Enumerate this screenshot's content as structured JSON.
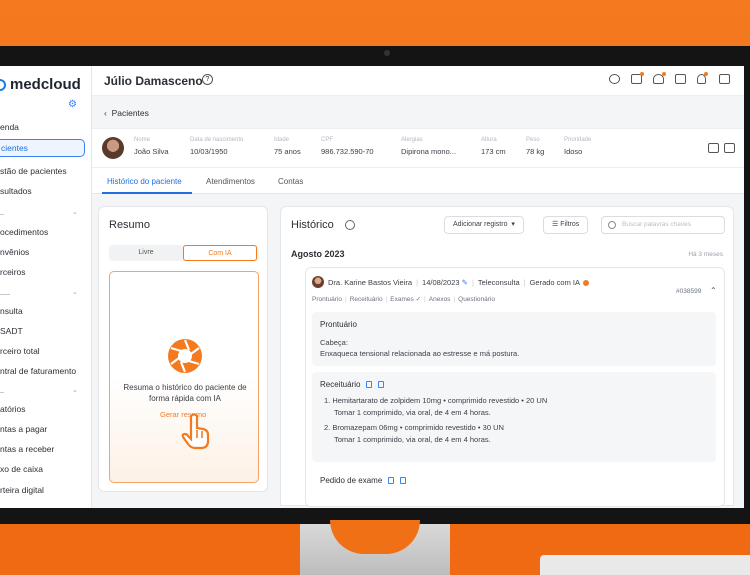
{
  "app": {
    "brand": "medcloud"
  },
  "sidebar": {
    "items": [
      {
        "label": "enda",
        "top": 0
      },
      {
        "label": "cientes"
      },
      {
        "label": "stão de pacientes"
      },
      {
        "label": "sultados"
      },
      {
        "label": "ocedimentos"
      },
      {
        "label": "nvênios"
      },
      {
        "label": "rceiros"
      },
      {
        "label": "nsulta"
      },
      {
        "label": "SADT"
      },
      {
        "label": "rceiro total"
      },
      {
        "label": "ntral de faturamento"
      },
      {
        "label": "atórios"
      },
      {
        "label": "ntas a pagar"
      },
      {
        "label": "ntas a receber"
      },
      {
        "label": "xo de caixa"
      },
      {
        "label": "rteira digital"
      }
    ]
  },
  "header": {
    "title": "Júlio Damasceno"
  },
  "breadcrumb": {
    "label": "Pacientes"
  },
  "patient": {
    "fields": [
      {
        "label": "Nome",
        "value": "João Silva"
      },
      {
        "label": "Data de nascimento",
        "value": "10/03/1950"
      },
      {
        "label": "Idade",
        "value": "75 anos"
      },
      {
        "label": "CPF",
        "value": "986.732.590-70"
      },
      {
        "label": "Alergias",
        "value": "Dipirona mono..."
      },
      {
        "label": "Altura",
        "value": "173 cm"
      },
      {
        "label": "Peso",
        "value": "78 kg"
      },
      {
        "label": "Prioridade",
        "value": "Idoso"
      }
    ]
  },
  "tabs": [
    {
      "label": "Histórico do paciente"
    },
    {
      "label": "Atendimentos"
    },
    {
      "label": "Contas"
    }
  ],
  "resumo": {
    "title": "Resumo",
    "options": [
      "Livre",
      "Com IA"
    ],
    "ai_text": "Resuma o histórico do paciente de forma rápida com IA",
    "ai_link": "Gerar resumo"
  },
  "historico": {
    "title": "Histórico",
    "add_button": "Adicionar registro",
    "filter_button": "Filtros",
    "search_placeholder": "Buscar palavras chaves",
    "month": "Agosto 2023",
    "month_ago": "Há 3 meses",
    "record": {
      "doctor": "Dra. Karine Bastos Vieira",
      "date": "14/08/2023",
      "type": "Teleconsulta",
      "generated": "Gerado com  IA",
      "id": "#038599",
      "subtabs": [
        "Prontuário",
        "Receituário",
        "Exames",
        "Anexos",
        "Questionário"
      ],
      "prontuario_title": "Prontuário",
      "cabeca_label": "Cabeça:",
      "cabeca_text": "Enxaqueca tensional relacionada ao estresse e má postura.",
      "receituario_title": "Receituário",
      "rx": [
        {
          "line1": "1. Hemitartarato de zolpidem 10mg • comprimido revestido • 20 UN",
          "line2": "Tomar 1 comprimido, via oral, de 4 em 4 horas."
        },
        {
          "line1": "2. Bromazepam 06mg • comprimido revestido • 30 UN",
          "line2": "Tomar 1 comprimido, via oral, de 4 em 4 horas."
        }
      ],
      "exame_title": "Pedido de exame"
    }
  },
  "colors": {
    "accent": "#f47a1f",
    "primary": "#1f6fe0"
  }
}
